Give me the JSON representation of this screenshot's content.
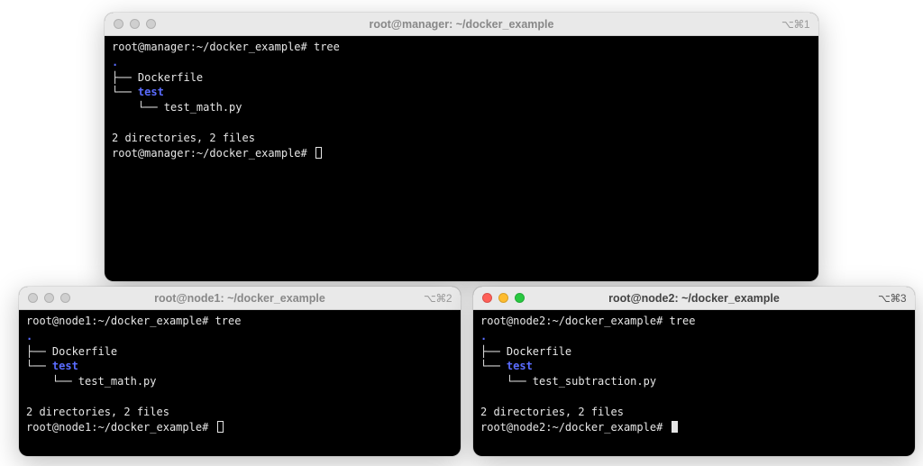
{
  "windows": {
    "top": {
      "title": "root@manager: ~/docker_example",
      "pane": "⌥⌘1",
      "focused": false,
      "prompt1": "root@manager:~/docker_example# ",
      "cmd1": "tree",
      "tree_dot": ".",
      "tree_l1": "├── Dockerfile",
      "tree_l2_prefix": "└── ",
      "tree_l2_dir": "test",
      "tree_l3": "    └── test_math.py",
      "summary_blank": "",
      "summary": "2 directories, 2 files",
      "prompt2": "root@manager:~/docker_example# "
    },
    "bl": {
      "title": "root@node1: ~/docker_example",
      "pane": "⌥⌘2",
      "focused": false,
      "prompt1": "root@node1:~/docker_example# ",
      "cmd1": "tree",
      "tree_dot": ".",
      "tree_l1": "├── Dockerfile",
      "tree_l2_prefix": "└── ",
      "tree_l2_dir": "test",
      "tree_l3": "    └── test_math.py",
      "summary": "2 directories, 2 files",
      "prompt2": "root@node1:~/docker_example# "
    },
    "br": {
      "title": "root@node2: ~/docker_example",
      "pane": "⌥⌘3",
      "focused": true,
      "prompt1": "root@node2:~/docker_example# ",
      "cmd1": "tree",
      "tree_dot": ".",
      "tree_l1": "├── Dockerfile",
      "tree_l2_prefix": "└── ",
      "tree_l2_dir": "test",
      "tree_l3": "    └── test_subtraction.py",
      "summary": "2 directories, 2 files",
      "prompt2": "root@node2:~/docker_example# "
    }
  }
}
